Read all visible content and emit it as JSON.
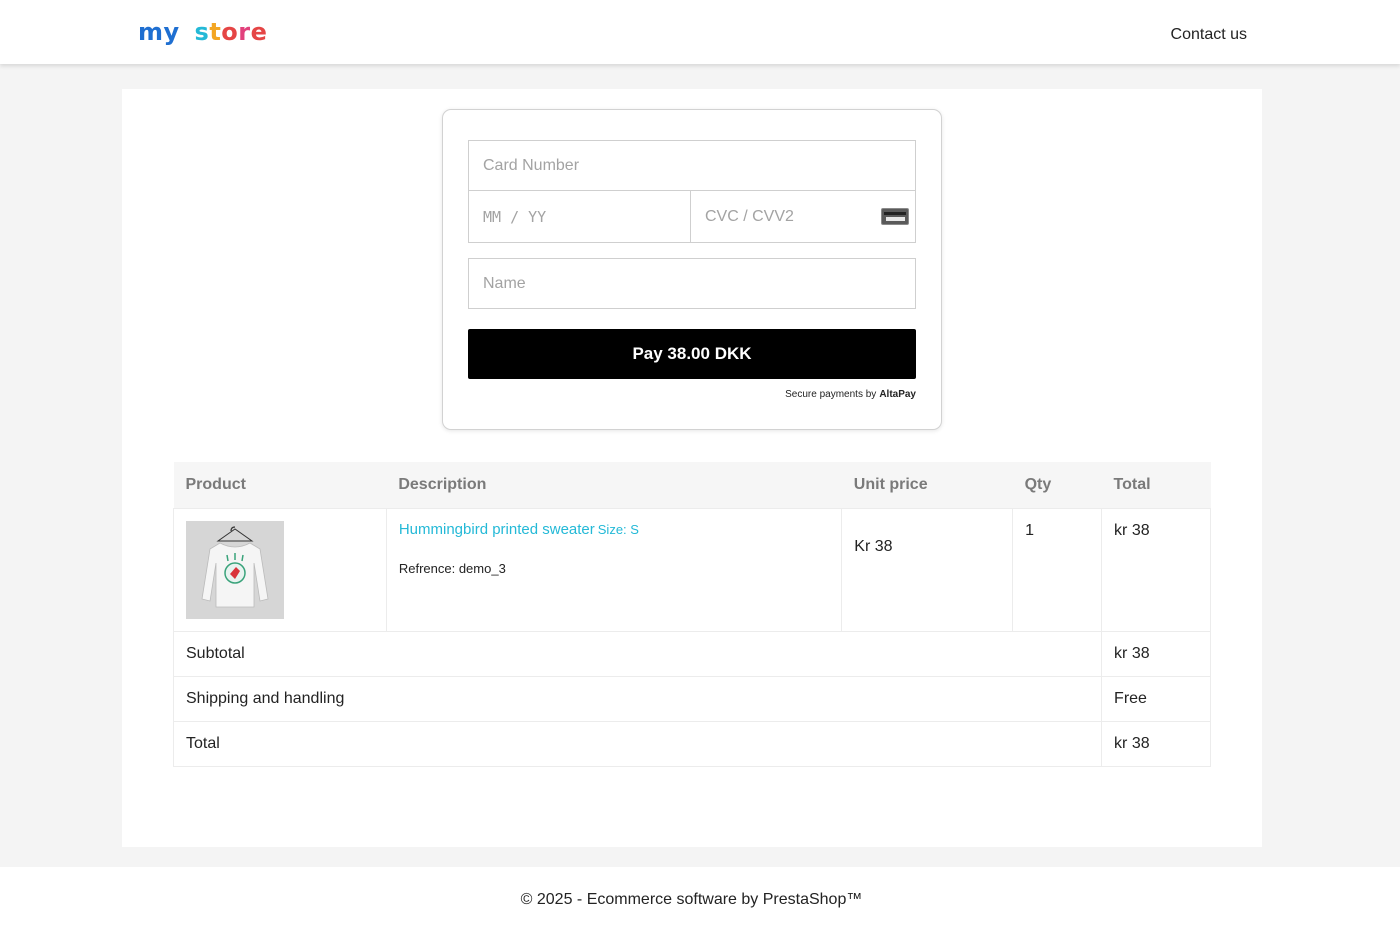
{
  "header": {
    "logo": {
      "p1": "my",
      "p2": "s",
      "p3": "t",
      "p4": "o",
      "p5": "r",
      "p6": "e"
    },
    "contact_label": "Contact us"
  },
  "payment": {
    "card_number_placeholder": "Card Number",
    "expiry_placeholder": "MM / YY",
    "cvc_placeholder": "CVC / CVV2",
    "name_placeholder": "Name",
    "pay_label": "Pay 38.00 DKK",
    "secure_label": "Secure payments by",
    "secure_brand": "AltaPay"
  },
  "cart": {
    "headers": [
      "Product",
      "Description",
      "Unit price",
      "Qty",
      "Total"
    ],
    "item": {
      "name": "Hummingbird printed sweater",
      "size": "Size: S",
      "reference": "Refrence: demo_3",
      "unit_price": "Kr 38",
      "qty": "1",
      "total": "kr 38"
    },
    "summary": [
      {
        "label": "Subtotal",
        "value": "kr 38"
      },
      {
        "label": "Shipping and handling",
        "value": "Free"
      },
      {
        "label": "Total",
        "value": "kr 38"
      }
    ]
  },
  "footer": {
    "copyright": "© 2025 - Ecommerce software by PrestaShop™"
  },
  "colors": {
    "link": "#24b9d7",
    "button_bg": "#000000",
    "page_bg": "#f4f4f4"
  }
}
